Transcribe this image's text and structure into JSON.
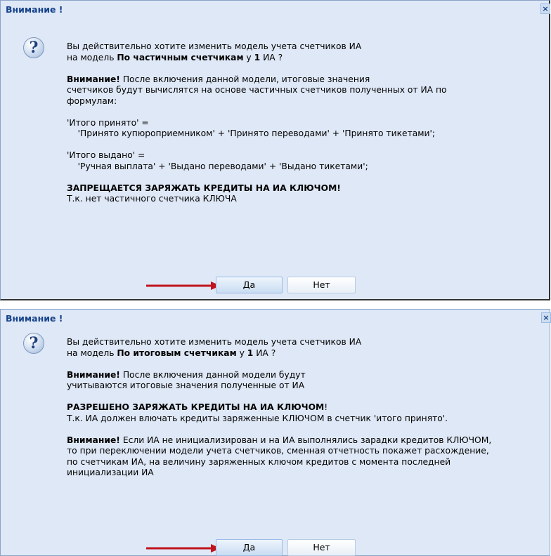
{
  "dialog1": {
    "title": "Внимание !",
    "close_label": "×",
    "icon": "question-icon",
    "line1": "Вы действительно хотите изменить модель учета счетчиков ИА",
    "line2_pre": "на модель ",
    "line2_bold": "По частичным счетчикам",
    "line2_mid": " у ",
    "line2_num": "1",
    "line2_post": " ИА ?",
    "warn_bold": "Внимание!",
    "warn_rest": " После включения данной модели, итоговые значения\nсчетчиков будут вычислятся на основе частичных счетчиков полученных от ИА по\nформулам:",
    "formula1": "'Итого принято' =\n    'Принято купюроприемником' + 'Принято переводами' + 'Принято тикетами';",
    "formula2": "'Итого выдано' =\n    'Ручная выплата' + 'Выдано переводами' + 'Выдано тикетами';",
    "prohibit_bold": "ЗАПРЕЩАЕТСЯ ЗАРЯЖАТЬ КРЕДИТЫ НА ИА КЛЮЧОМ!",
    "prohibit_reason": "Т.к. нет частичного счетчика КЛЮЧА",
    "yes_label": "Да",
    "no_label": "Нет",
    "arrow_color": "#c0141c"
  },
  "dialog2": {
    "title": "Внимание !",
    "close_label": "×",
    "icon": "question-icon",
    "line1": "Вы действительно хотите изменить модель учета счетчиков ИА",
    "line2_pre": "на модель ",
    "line2_bold": "По итоговым счетчикам",
    "line2_mid": " у ",
    "line2_num": "1",
    "line2_post": " ИА ?",
    "warn_bold": "Внимание!",
    "warn_rest": " После включения данной модели будут\nучитываются итоговые значения полученные от ИА",
    "allow_bold": "РАЗРЕШЕНО ЗАРЯЖАТЬ КРЕДИТЫ НА ИА КЛЮЧОМ",
    "allow_excl": "!",
    "allow_reason": "Т.к. ИА должен влючать кредиты заряженные КЛЮЧОМ в счетчик 'итого принято'.",
    "warn2_bold": "Внимание!",
    "warn2_rest": " Если ИА не инициализирован и на ИА выполнялись зарадки кредитов КЛЮЧОМ,\nто при переключении модели учета счетчиков, сменная отчетность покажет расхождение,\nпо счетчикам ИА, на величину заряженных ключом кредитов с момента последней\nинициализации ИА",
    "yes_label": "Да",
    "no_label": "Нет",
    "arrow_color": "#c0141c"
  }
}
